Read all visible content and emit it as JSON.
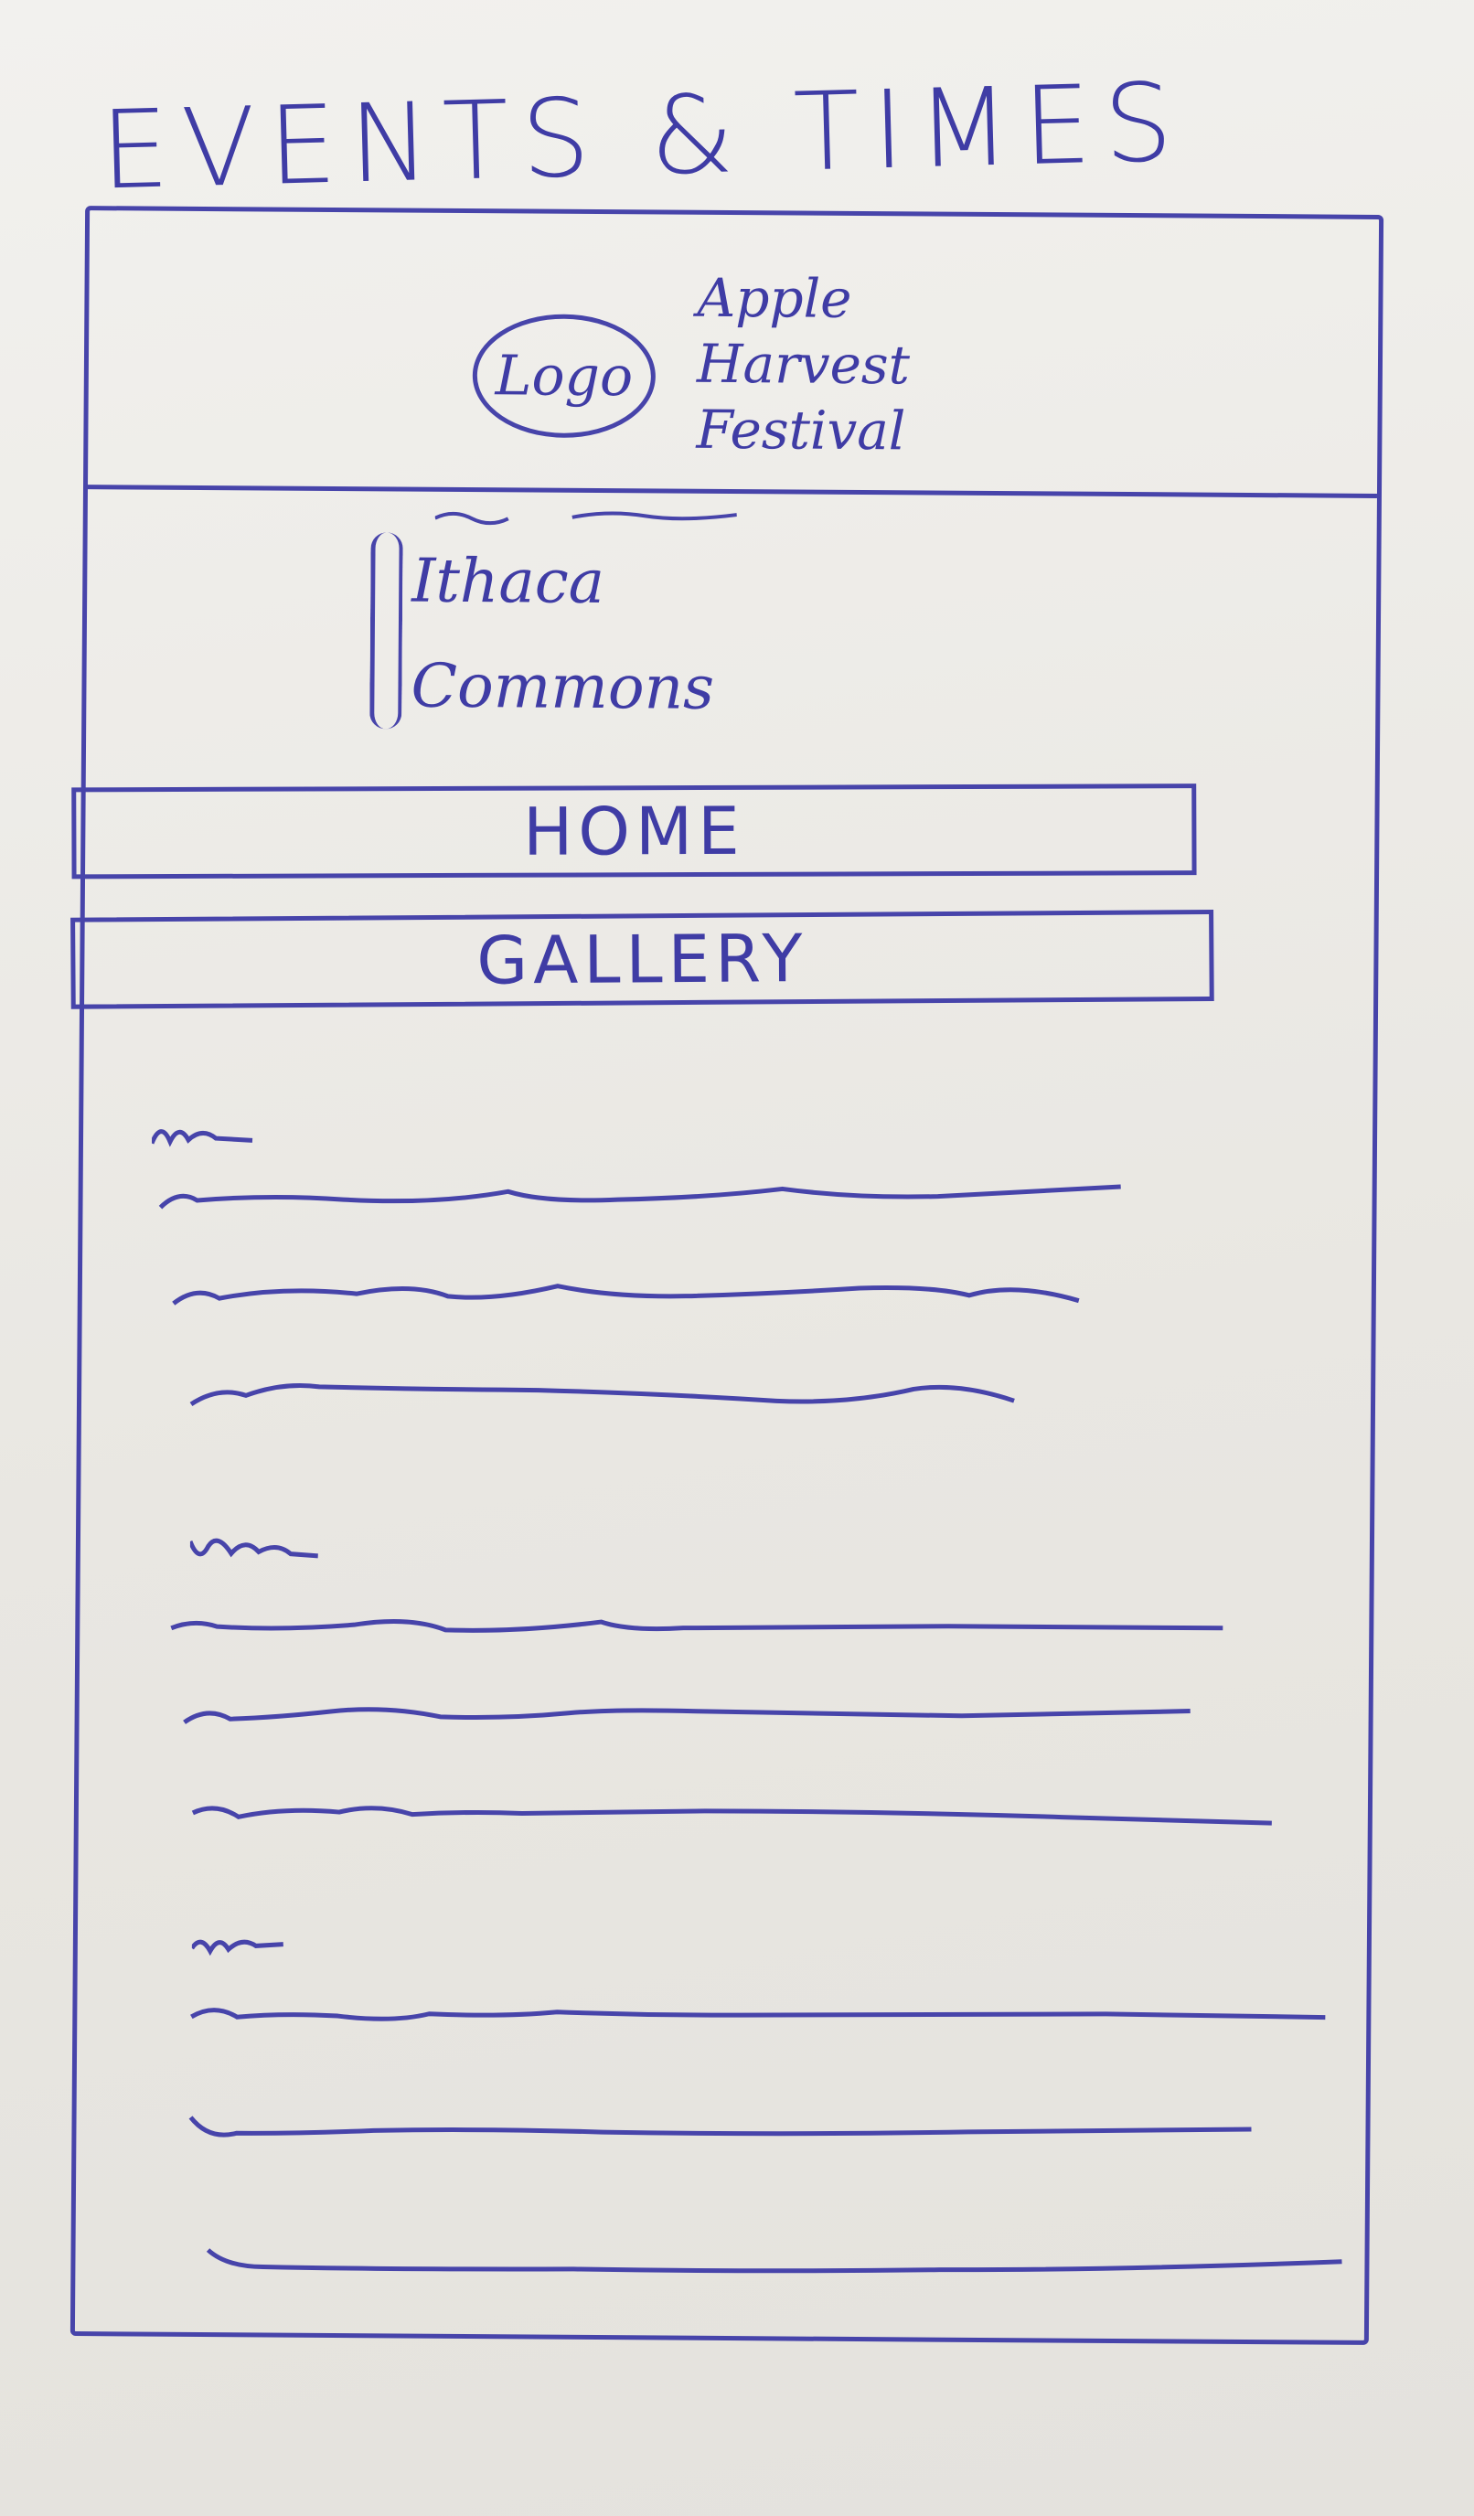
{
  "page_title": "EVENTS & TIMES",
  "header": {
    "logo_label": "Logo",
    "site_name_lines": [
      "Apple",
      "Harvest",
      "Festival"
    ]
  },
  "location": {
    "lines": [
      "Ithaca",
      "Commons"
    ]
  },
  "nav": {
    "home_label": "HOME",
    "gallery_label": "GALLERY"
  },
  "colors": {
    "ink": "#3f3ca5",
    "paper": "#eceae6"
  },
  "event_groups": [
    {
      "heading": "",
      "line_count": 3
    },
    {
      "heading": "",
      "line_count": 3
    },
    {
      "heading": "",
      "line_count": 3
    }
  ]
}
